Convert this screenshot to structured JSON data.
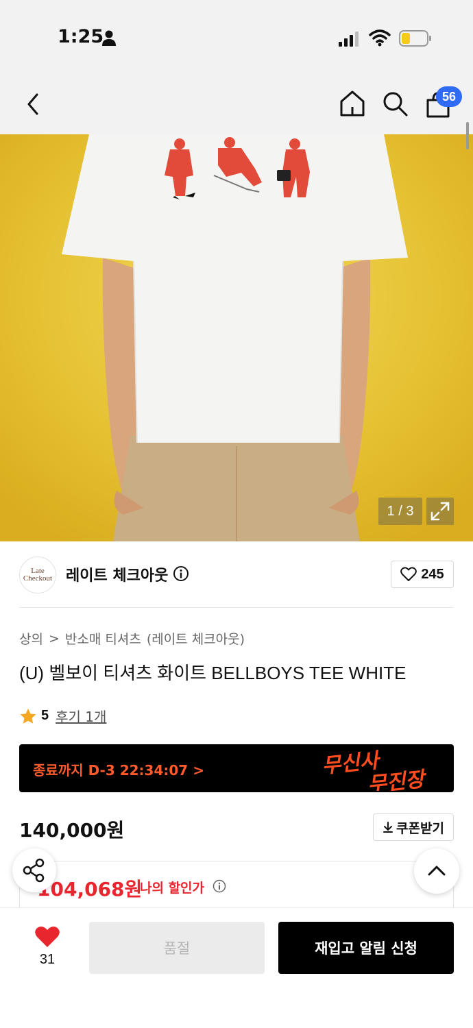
{
  "status_bar": {
    "time": "1:25"
  },
  "header": {
    "cart_count": "56"
  },
  "gallery": {
    "counter": "1 / 3"
  },
  "brand": {
    "logo_line1": "Late",
    "logo_line2": "Checkout",
    "name": "레이트 체크아웃",
    "likes": "245"
  },
  "breadcrumb": {
    "category": "상의",
    "separator": ">",
    "subcategory": "반소매 티셔츠",
    "brand": "(레이트 체크아웃)"
  },
  "product": {
    "title": "(U) 벨보이 티셔츠 화이트 BELLBOYS TEE WHITE",
    "rating": "5",
    "reviews": "후기 1개"
  },
  "promo": {
    "countdown": "종료까지 D-3 22:34:07",
    "chevron": ">",
    "art_line1": "무신사",
    "art_line2": "무진장"
  },
  "price": {
    "original": "140,000원",
    "coupon_label": "쿠폰받기",
    "discount_price": "104,068원",
    "discount_label": "나의 할인가"
  },
  "bottom": {
    "like_count": "31",
    "soldout_label": "품절",
    "restock_label": "재입고 알림 신청"
  },
  "colors": {
    "accent_blue": "#2f6bf5",
    "discount_red": "#e8262e",
    "promo_orange": "#ff5a2c",
    "hero_yellow": "#e7c437"
  }
}
